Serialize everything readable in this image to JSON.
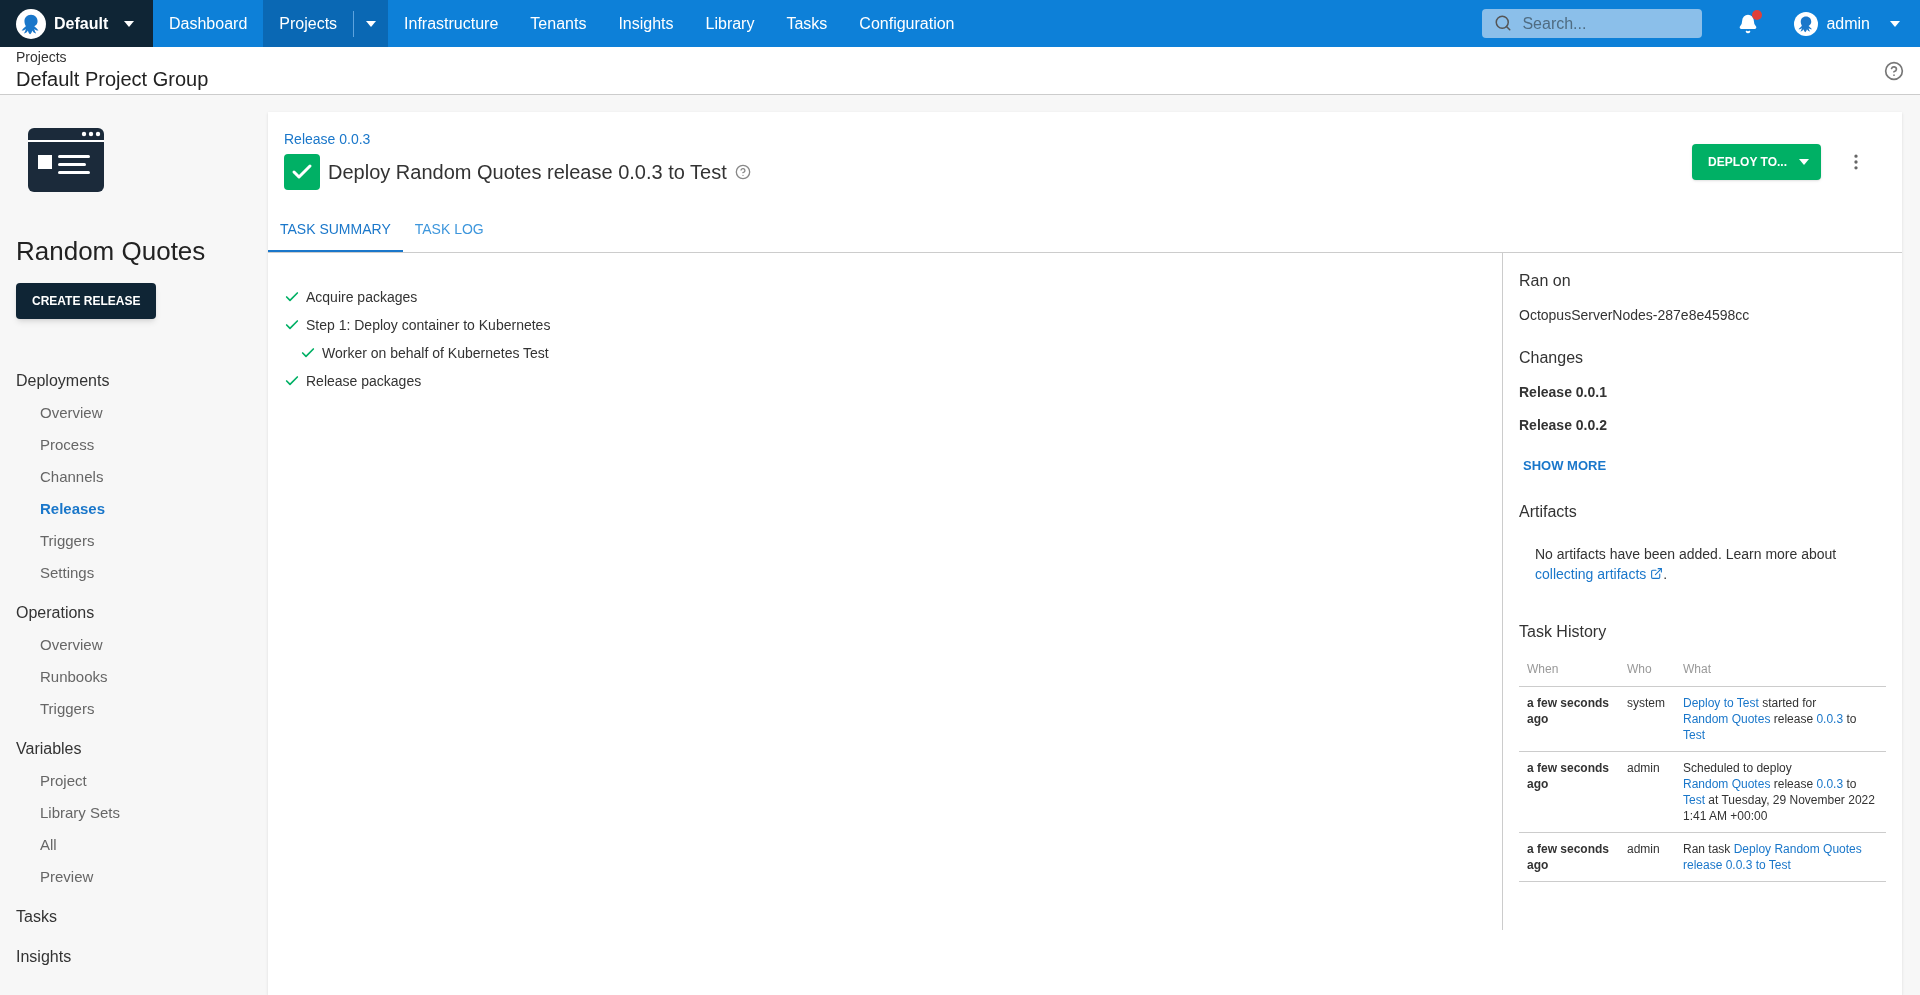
{
  "space_selector": {
    "label": "Default"
  },
  "nav": [
    {
      "label": "Dashboard",
      "selected": false,
      "kind": "link"
    },
    {
      "label": "Projects",
      "selected": true,
      "kind": "dropdown"
    },
    {
      "label": "Infrastructure",
      "selected": false,
      "kind": "link"
    },
    {
      "label": "Tenants",
      "selected": false,
      "kind": "link"
    },
    {
      "label": "Insights",
      "selected": false,
      "kind": "link"
    },
    {
      "label": "Library",
      "selected": false,
      "kind": "link"
    },
    {
      "label": "Tasks",
      "selected": false,
      "kind": "link"
    },
    {
      "label": "Configuration",
      "selected": false,
      "kind": "link"
    }
  ],
  "search": {
    "placeholder": "Search..."
  },
  "notifications": {
    "unread": true
  },
  "user": {
    "name": "admin"
  },
  "breadcrumb": {
    "parent": "Projects",
    "title": "Default Project Group"
  },
  "project": {
    "name": "Random Quotes",
    "create_button": "CREATE RELEASE"
  },
  "sidebar": [
    {
      "label": "Deployments",
      "children": [
        {
          "label": "Overview",
          "selected": false
        },
        {
          "label": "Process",
          "selected": false
        },
        {
          "label": "Channels",
          "selected": false
        },
        {
          "label": "Releases",
          "selected": true
        },
        {
          "label": "Triggers",
          "selected": false
        },
        {
          "label": "Settings",
          "selected": false
        }
      ]
    },
    {
      "label": "Operations",
      "children": [
        {
          "label": "Overview",
          "selected": false
        },
        {
          "label": "Runbooks",
          "selected": false
        },
        {
          "label": "Triggers",
          "selected": false
        }
      ]
    },
    {
      "label": "Variables",
      "children": [
        {
          "label": "Project",
          "selected": false
        },
        {
          "label": "Library Sets",
          "selected": false
        },
        {
          "label": "All",
          "selected": false
        },
        {
          "label": "Preview",
          "selected": false
        }
      ]
    },
    {
      "label": "Tasks"
    },
    {
      "label": "Insights"
    }
  ],
  "task": {
    "release_link": "Release 0.0.3",
    "title": "Deploy Random Quotes release 0.0.3 to Test",
    "succeeded": true,
    "deploy_button": "DEPLOY TO..."
  },
  "tabs": [
    {
      "label": "TASK SUMMARY",
      "selected": true
    },
    {
      "label": "TASK LOG",
      "selected": false
    }
  ],
  "steps": [
    {
      "label": "Acquire packages",
      "done": true
    },
    {
      "label": "Step 1: Deploy container to Kubernetes",
      "done": true,
      "children": [
        {
          "label": "Worker on behalf of Kubernetes Test",
          "done": true
        }
      ]
    },
    {
      "label": "Release packages",
      "done": true
    }
  ],
  "details": {
    "ran_on_heading": "Ran on",
    "ran_on": "OctopusServerNodes-287e8e4598cc",
    "changes_heading": "Changes",
    "changes": [
      "Release 0.0.1",
      "Release 0.0.2"
    ],
    "show_more": "SHOW MORE",
    "artifacts_heading": "Artifacts",
    "artifacts_text": "No artifacts have been added. Learn more about ",
    "artifacts_link": "collecting artifacts",
    "artifacts_end": ".",
    "history_heading": "Task History",
    "history_columns": [
      "When",
      "Who",
      "What"
    ],
    "history": [
      {
        "when": "a few seconds ago",
        "who": "system",
        "what": [
          {
            "text": "Deploy to Test",
            "link": true
          },
          {
            "text": " started for ",
            "link": false
          },
          {
            "text": "Random Quotes",
            "link": true
          },
          {
            "text": " release ",
            "link": false
          },
          {
            "text": "0.0.3",
            "link": true
          },
          {
            "text": " to ",
            "link": false
          },
          {
            "text": "Test",
            "link": true
          }
        ]
      },
      {
        "when": "a few seconds ago",
        "who": "admin",
        "what": [
          {
            "text": "Scheduled to deploy ",
            "link": false
          },
          {
            "text": "Random Quotes",
            "link": true
          },
          {
            "text": " release ",
            "link": false
          },
          {
            "text": "0.0.3",
            "link": true
          },
          {
            "text": " to ",
            "link": false
          },
          {
            "text": "Test",
            "link": true
          },
          {
            "text": " at Tuesday, 29 November 2022 1:41 AM +00:00",
            "link": false
          }
        ]
      },
      {
        "when": "a few seconds ago",
        "who": "admin",
        "what": [
          {
            "text": "Ran task ",
            "link": false
          },
          {
            "text": "Deploy Random Quotes",
            "link": true
          },
          {
            "text": "release 0.0.3 to Test",
            "link": true
          }
        ]
      }
    ]
  }
}
